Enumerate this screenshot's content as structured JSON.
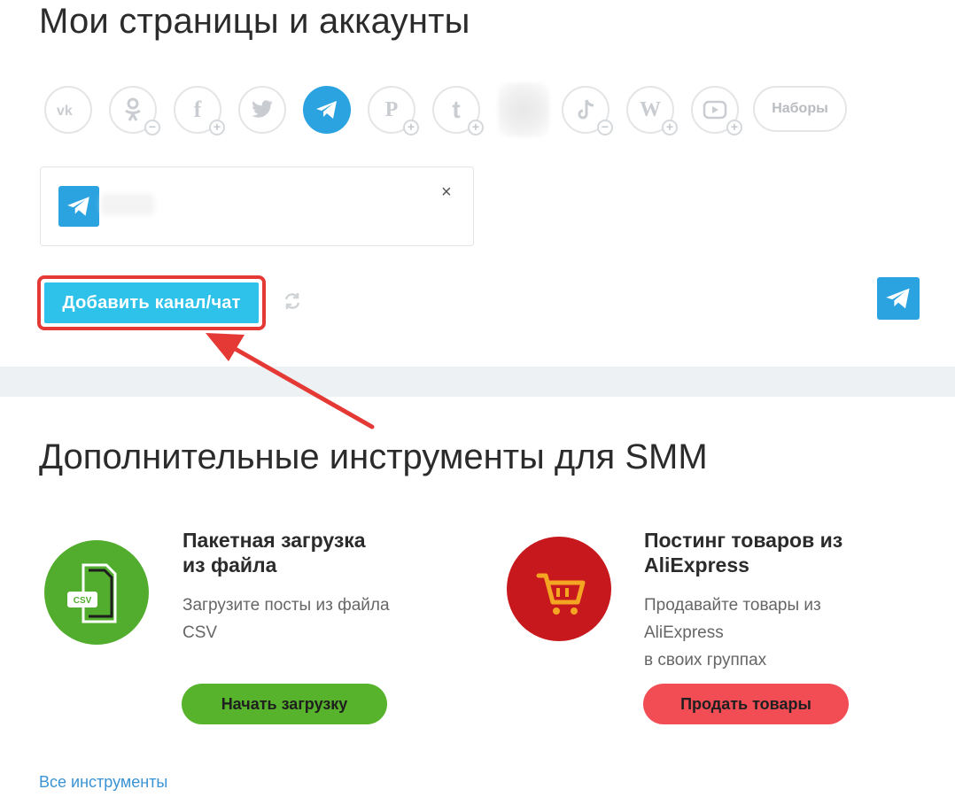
{
  "accounts_section": {
    "title": "Мои страницы и аккаунты",
    "social_networks": [
      {
        "name": "vk",
        "label": "vk",
        "active": false,
        "badge": ""
      },
      {
        "name": "odnoklassniki",
        "label": "ok",
        "active": false,
        "badge": "−"
      },
      {
        "name": "facebook",
        "label": "f",
        "active": false,
        "badge": "+"
      },
      {
        "name": "twitter",
        "label": "",
        "active": false,
        "badge": ""
      },
      {
        "name": "telegram",
        "label": "",
        "active": true,
        "badge": ""
      },
      {
        "name": "pinterest",
        "label": "P",
        "active": false,
        "badge": "+"
      },
      {
        "name": "tumblr",
        "label": "t",
        "active": false,
        "badge": "+"
      },
      {
        "name": "tiktok",
        "label": "",
        "active": false,
        "badge": "−"
      },
      {
        "name": "wordpress",
        "label": "W",
        "active": false,
        "badge": "+"
      },
      {
        "name": "youtube",
        "label": "",
        "active": false,
        "badge": "+"
      }
    ],
    "collections_label": "Наборы",
    "add_channel_button": "Добавить канал/чат",
    "close_symbol": "×"
  },
  "tools_section": {
    "title": "Дополнительные инструменты для SMM",
    "tools": [
      {
        "title_line1": "Пакетная загрузка",
        "title_line2": "из файла",
        "desc_line1": "Загрузите посты из файла",
        "desc_line2": "CSV",
        "desc_line3": "",
        "button": "Начать загрузку",
        "icon_badge": "CSV",
        "accent": "#52ad2e",
        "button_color": "#56b32b"
      },
      {
        "title_line1": "Постинг товаров из",
        "title_line2": "AliExpress",
        "desc_line1": "Продавайте товары из",
        "desc_line2": "AliExpress",
        "desc_line3": "в своих группах",
        "button": "Продать товары",
        "icon_badge": "",
        "accent": "#c7191d",
        "button_color": "#f24d55"
      }
    ],
    "all_tools_link": "Все инструменты"
  },
  "colors": {
    "telegram": "#2aa3e0",
    "add_button": "#2ec1ea",
    "highlight": "#e53935",
    "link": "#3a93d4"
  }
}
